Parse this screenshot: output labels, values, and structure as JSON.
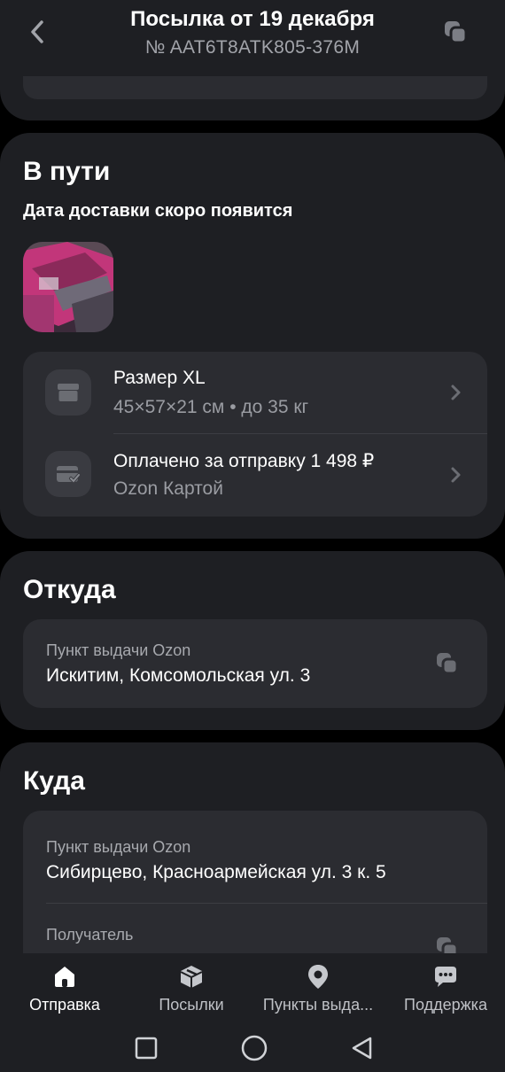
{
  "header": {
    "title": "Посылка от 19 декабря",
    "tracking_number": "№ AAT6T8ATK805-376M"
  },
  "transit": {
    "title": "В пути",
    "subtitle": "Дата доставки скоро появится",
    "size_row": {
      "title": "Размер XL",
      "sub": "45×57×21 см • до 35 кг",
      "icon": "box-icon"
    },
    "payment_row": {
      "title": "Оплачено за отправку 1 498 ₽",
      "sub": "Ozon Картой",
      "icon": "card-paid-icon"
    }
  },
  "from": {
    "title": "Откуда",
    "label": "Пункт выдачи Ozon",
    "address": "Искитим, Комсомольская ул. 3"
  },
  "to": {
    "title": "Куда",
    "label": "Пункт выдачи Ozon",
    "address": "Сибирцево, Красноармейская ул. 3 к. 5",
    "recipient_label": "Получатель"
  },
  "bottom_nav": {
    "items": [
      {
        "label": "Отправка",
        "icon": "home-icon",
        "active": true
      },
      {
        "label": "Посылки",
        "icon": "parcel-icon",
        "active": false
      },
      {
        "label": "Пункты выда...",
        "icon": "location-pin-icon",
        "active": false
      },
      {
        "label": "Поддержка",
        "icon": "chat-icon",
        "active": false
      }
    ]
  },
  "colors": {
    "background": "#000000",
    "card": "#1e1f23",
    "panel": "#2b2c31",
    "icon_bg": "#3a3b41",
    "muted_text": "#9a9ca2"
  }
}
